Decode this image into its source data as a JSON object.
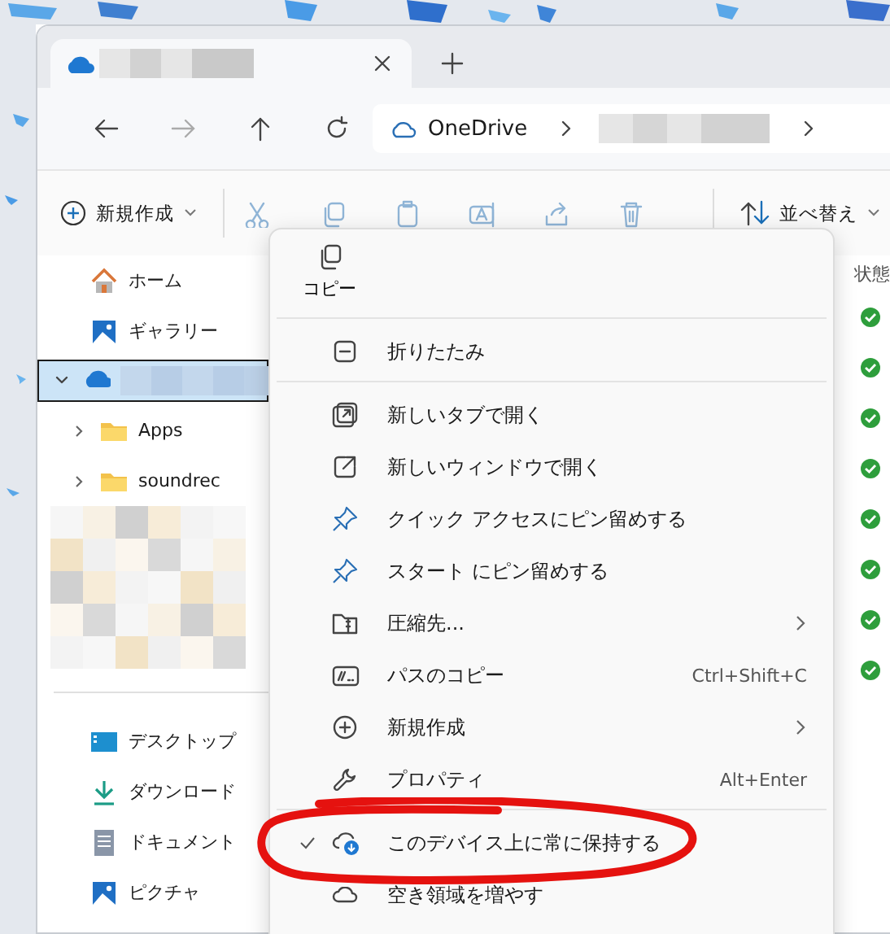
{
  "address": {
    "location": "OneDrive"
  },
  "toolbar": {
    "new_button": "新規作成",
    "sort_button": "並べ替え"
  },
  "sidebar": {
    "items": [
      {
        "kind": "home",
        "label": "ホーム",
        "selected": false
      },
      {
        "kind": "gallery",
        "label": "ギャラリー",
        "selected": false
      },
      {
        "kind": "onedrive",
        "selected": true,
        "expanded": true,
        "children": [
          {
            "kind": "folder",
            "label": "Apps",
            "selected": false,
            "expanded": false
          },
          {
            "kind": "folder",
            "label": "soundrec",
            "selected": false,
            "expanded": false
          }
        ]
      }
    ],
    "quick_access": [
      {
        "kind": "desktop",
        "label": "デスクトップ"
      },
      {
        "kind": "download",
        "label": "ダウンロード"
      },
      {
        "kind": "documents",
        "label": "ドキュメント"
      },
      {
        "kind": "pictures",
        "label": "ピクチャ"
      }
    ]
  },
  "file_list": {
    "column": "状態",
    "rows": [
      {
        "synced": true
      },
      {
        "synced": true
      },
      {
        "synced": true
      },
      {
        "synced": true
      },
      {
        "synced": true
      },
      {
        "synced": true
      },
      {
        "synced": true
      },
      {
        "synced": true
      }
    ]
  },
  "context_menu": {
    "top_actions": [
      {
        "kind": "copy",
        "label": "コピー"
      }
    ],
    "groups": [
      [
        {
          "kind": "collapse",
          "label": "折りたたみ",
          "submenu": false,
          "checked": false
        }
      ],
      [
        {
          "kind": "new-tab",
          "label": "新しいタブで開く",
          "submenu": false,
          "checked": false
        },
        {
          "kind": "new-window",
          "label": "新しいウィンドウで開く",
          "submenu": false,
          "checked": false
        },
        {
          "kind": "pin",
          "label": "クイック アクセスにピン留めする",
          "submenu": false,
          "checked": false
        },
        {
          "kind": "pin",
          "label": "スタート にピン留めする",
          "submenu": false,
          "checked": false
        },
        {
          "kind": "zip",
          "label": "圧縮先...",
          "submenu": true,
          "checked": false
        },
        {
          "kind": "path",
          "label": "パスのコピー",
          "shortcut": "Ctrl+Shift+C",
          "submenu": false,
          "checked": false
        },
        {
          "kind": "new",
          "label": "新規作成",
          "submenu": true,
          "checked": false
        },
        {
          "kind": "properties",
          "label": "プロパティ",
          "shortcut": "Alt+Enter",
          "submenu": false,
          "checked": false
        }
      ],
      [
        {
          "kind": "keep",
          "label": "このデバイス上に常に保持する",
          "submenu": false,
          "checked": true
        },
        {
          "kind": "free",
          "label": "空き領域を増やす",
          "submenu": false,
          "checked": false
        }
      ]
    ]
  },
  "annotation": {
    "kind": "circle"
  }
}
